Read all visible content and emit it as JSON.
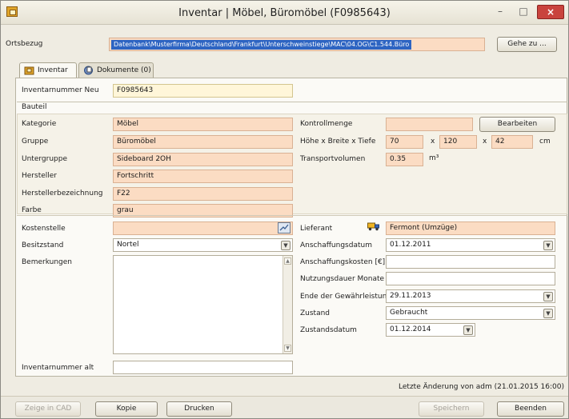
{
  "window": {
    "title": "Inventar | Möbel, Büromöbel (F0985643)",
    "min": "–",
    "max": "□",
    "close": "×"
  },
  "ortsbezug": {
    "label": "Ortsbezug",
    "value": "Datenbank\\Musterfirma\\Deutschland\\Frankfurt\\Unterschweinstiege\\MAC\\04.OG\\C1.544.Büro",
    "goto_button": "Gehe zu ..."
  },
  "tabs": [
    {
      "label": "Inventar"
    },
    {
      "label": "Dokumente (0)"
    }
  ],
  "left": {
    "inventarnummer_neu": {
      "label": "Inventarnummer Neu",
      "value": "F0985643"
    },
    "bauteil_header": "Bauteil",
    "kategorie": {
      "label": "Kategorie",
      "value": "Möbel"
    },
    "gruppe": {
      "label": "Gruppe",
      "value": "Büromöbel"
    },
    "untergruppe": {
      "label": "Untergruppe",
      "value": "Sideboard 2OH"
    },
    "hersteller": {
      "label": "Hersteller",
      "value": "Fortschritt"
    },
    "herstellerbezeichnung": {
      "label": "Herstellerbezeichnung",
      "value": "F22"
    },
    "farbe": {
      "label": "Farbe",
      "value": "grau"
    },
    "kostenstelle": {
      "label": "Kostenstelle",
      "value": ""
    },
    "besitzstand": {
      "label": "Besitzstand",
      "value": "Nortel"
    },
    "bemerkungen": {
      "label": "Bemerkungen",
      "value": ""
    },
    "inventarnummer_alt": {
      "label": "Inventarnummer alt",
      "value": ""
    }
  },
  "right": {
    "kontrollmenge": {
      "label": "Kontrollmenge",
      "value": ""
    },
    "bearbeiten_button": "Bearbeiten",
    "dimensions": {
      "label": "Höhe x Breite x Tiefe",
      "h": "70",
      "b": "120",
      "t": "42",
      "sep": "x",
      "unit": "cm"
    },
    "transportvolumen": {
      "label": "Transportvolumen",
      "value": "0.35",
      "unit": "m³"
    },
    "lieferant": {
      "label": "Lieferant",
      "value": "Fermont (Umzüge)"
    },
    "anschaffungsdatum": {
      "label": "Anschaffungsdatum",
      "value": "01.12.2011"
    },
    "anschaffungskosten": {
      "label": "Anschaffungskosten [€]",
      "value": ""
    },
    "nutzungsdauer": {
      "label": "Nutzungsdauer Monate",
      "value": ""
    },
    "gewaehrleistung": {
      "label": "Ende der Gewährleistung",
      "value": "29.11.2013"
    },
    "zustand": {
      "label": "Zustand",
      "value": "Gebraucht"
    },
    "zustandsdatum": {
      "label": "Zustandsdatum",
      "value": "01.12.2014"
    }
  },
  "status": "Letzte Änderung von adm (21.01.2015 16:00)",
  "footer": {
    "zeige_in_cad": "Zeige in CAD",
    "kopie": "Kopie",
    "drucken": "Drucken",
    "speichern": "Speichern",
    "beenden": "Beenden"
  },
  "colors": {
    "required_field": "#fbdcc3",
    "key_field": "#fff6d9",
    "close_button": "#c9433d",
    "selection": "#2d64c2"
  }
}
